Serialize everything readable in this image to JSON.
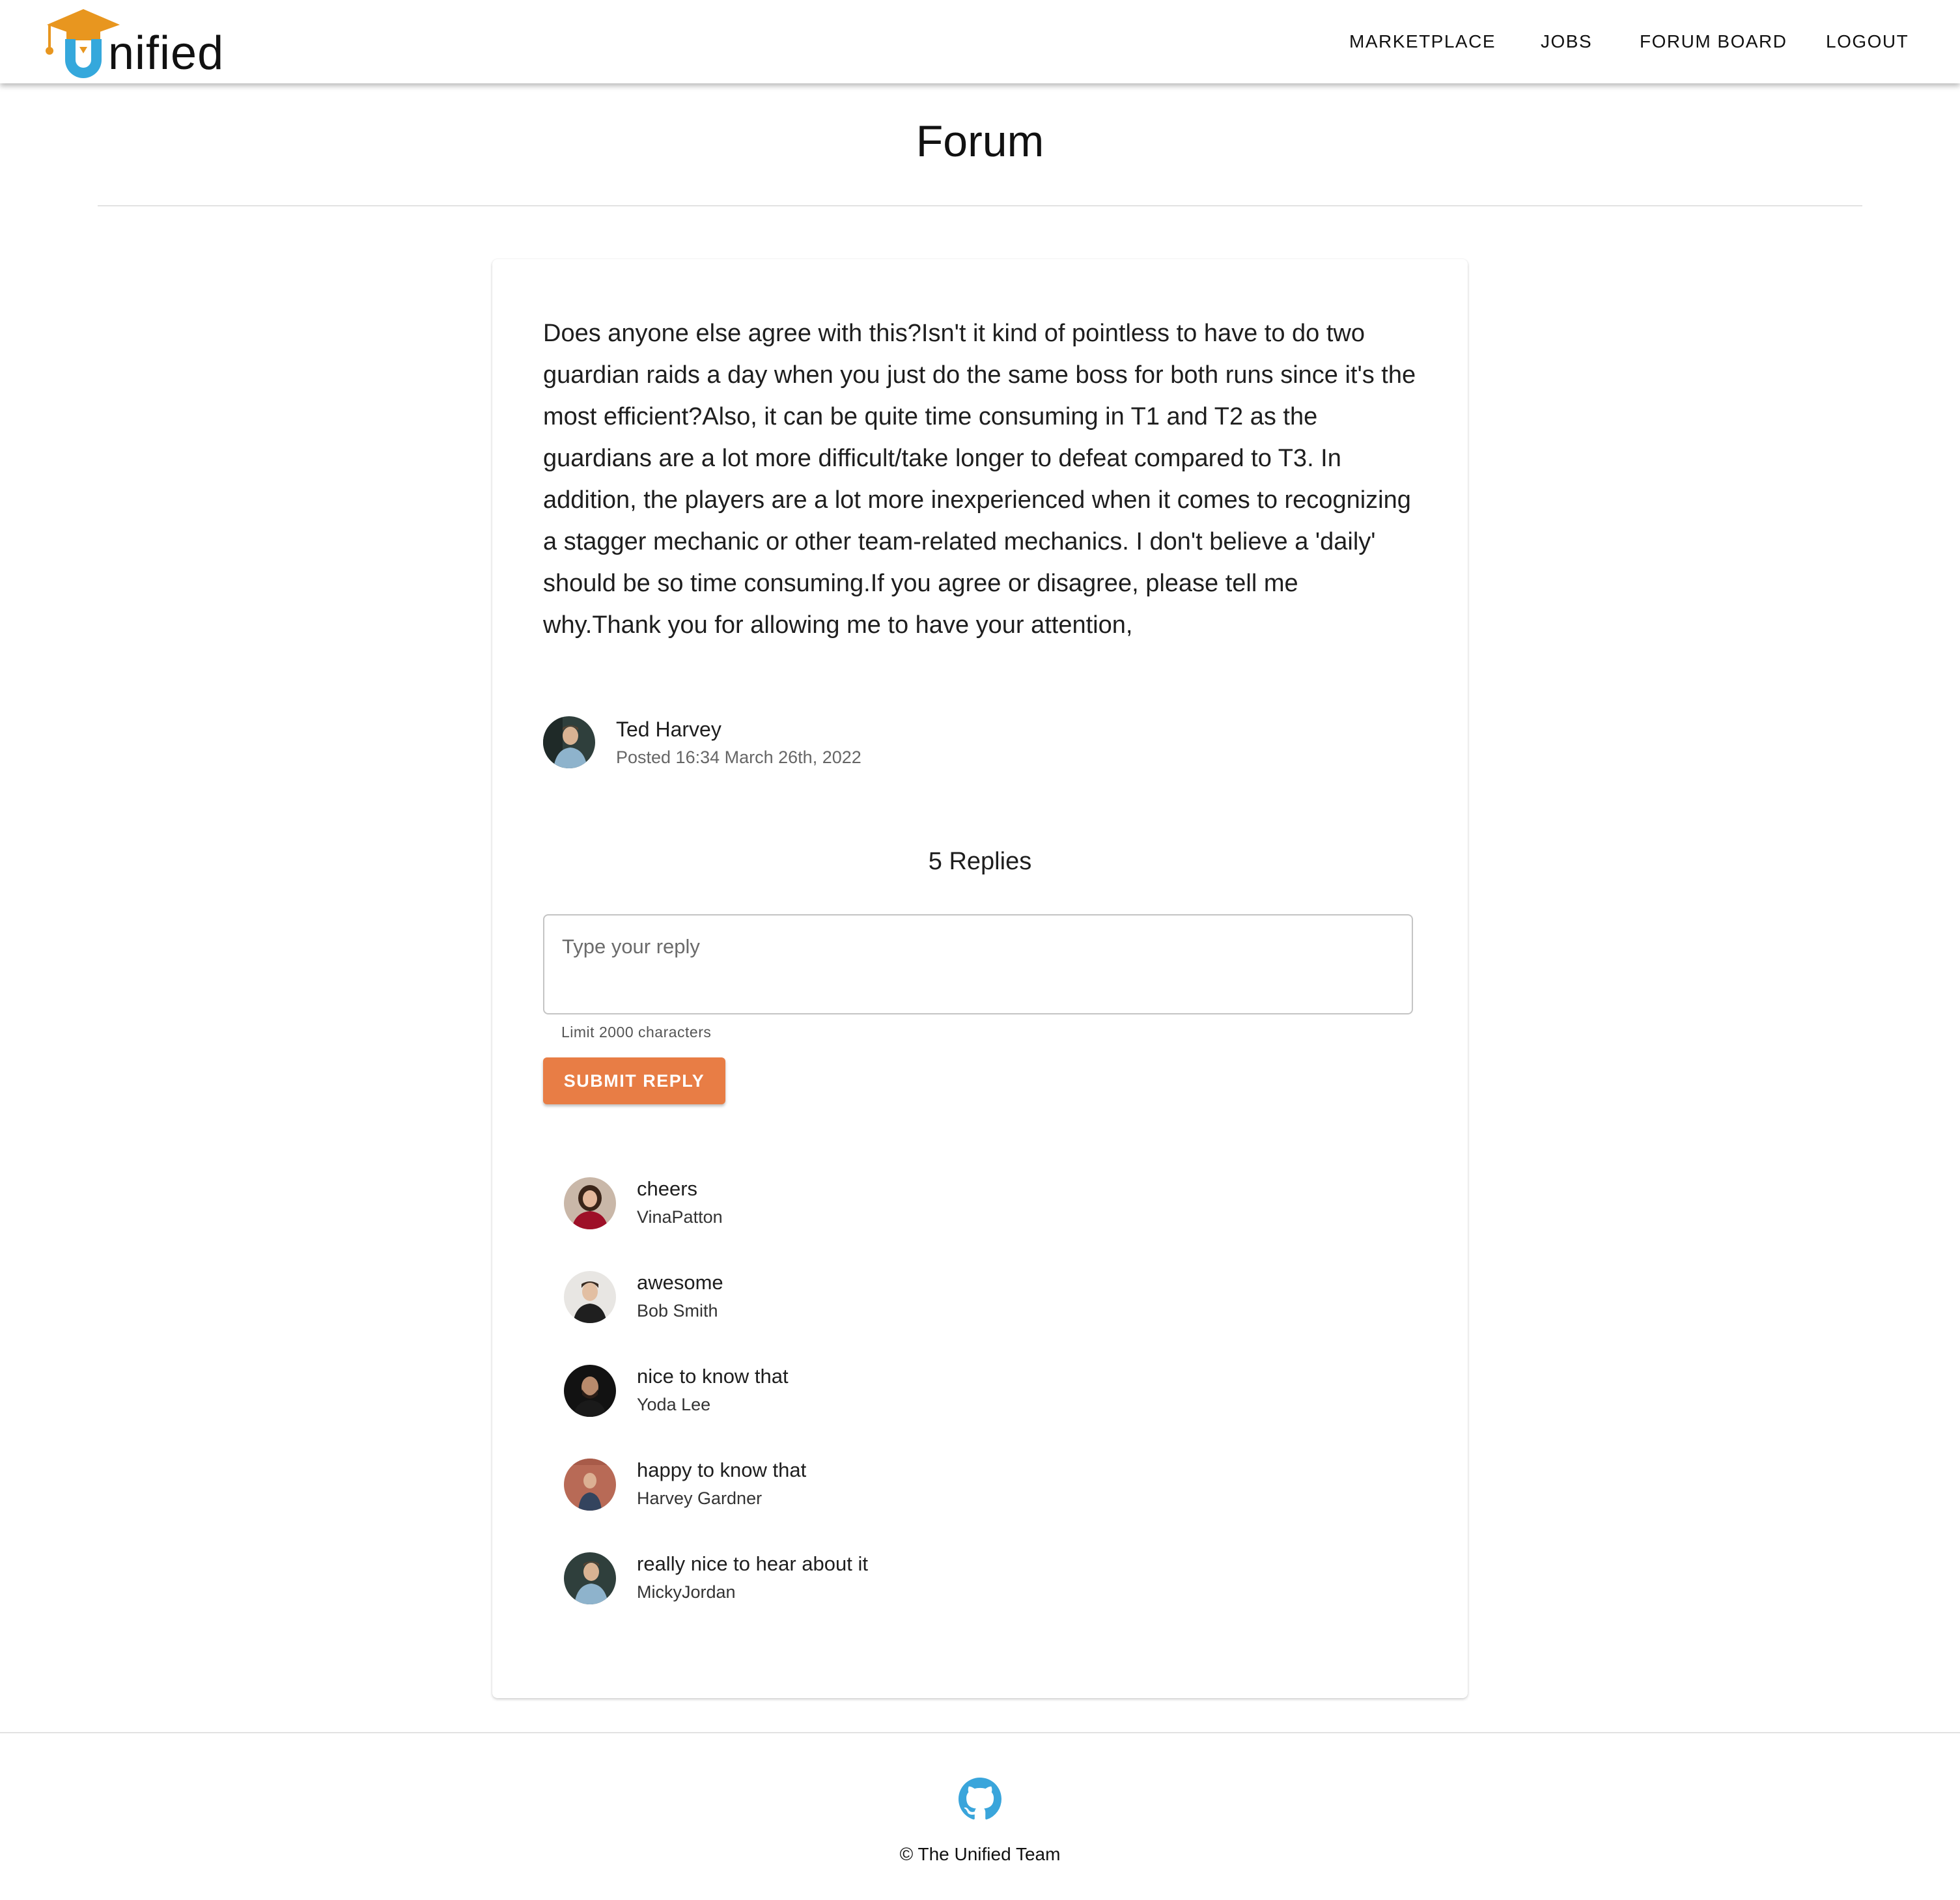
{
  "header": {
    "logo_text": "nified",
    "nav": [
      "MARKETPLACE",
      "JOBS",
      "FORUM BOARD",
      "LOGOUT"
    ]
  },
  "page": {
    "title": "Forum"
  },
  "post": {
    "body": "Does anyone else agree with this?Isn't it kind of pointless to have to do two guardian raids a day when you just do the same boss for both runs since it's the most efficient?Also, it can be quite time consuming in T1 and T2 as the guardians are a lot more difficult/take longer to defeat compared to T3. In addition, the players are a lot more inexperienced when it comes to recognizing a stagger mechanic or other team-related mechanics. I don't believe a 'daily' should be so time consuming.If you agree or disagree, please tell me why.Thank you for allowing me to have your attention,",
    "author": "Ted Harvey",
    "posted": "Posted 16:34 March 26th, 2022"
  },
  "replies_section": {
    "count_label": "5 Replies",
    "input_placeholder": "Type your reply",
    "helper_text": "Limit 2000 characters",
    "submit_label": "SUBMIT REPLY"
  },
  "replies": [
    {
      "text": "cheers",
      "author": "VinaPatton"
    },
    {
      "text": "awesome",
      "author": "Bob Smith"
    },
    {
      "text": "nice to know that",
      "author": "Yoda Lee"
    },
    {
      "text": "happy to know that",
      "author": "Harvey Gardner"
    },
    {
      "text": "really nice to hear about it",
      "author": "MickyJordan"
    }
  ],
  "footer": {
    "copyright": "© The Unified Team",
    "icon": "github-icon"
  },
  "colors": {
    "accent": "#e87d45",
    "logo_cap": "#e8961f",
    "logo_u": "#35a8dc",
    "github": "#3aa5db"
  }
}
